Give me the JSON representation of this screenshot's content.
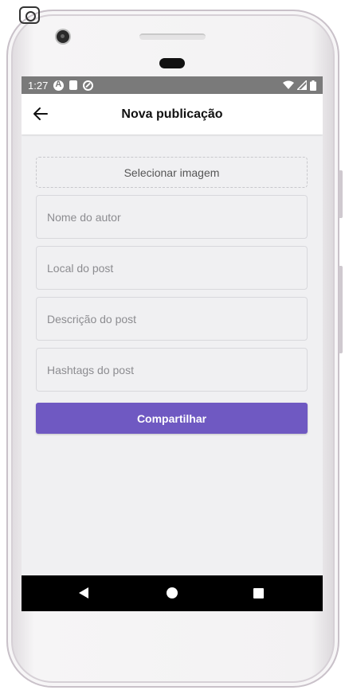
{
  "status_bar": {
    "time": "1:27",
    "icons": [
      "app-a-icon",
      "sd-card-icon",
      "do-not-disturb-icon",
      "wifi-icon",
      "signal-icon",
      "battery-icon"
    ]
  },
  "header": {
    "title": "Nova publicação",
    "back_icon": "arrow-left-icon"
  },
  "form": {
    "image_picker_label": "Selecionar imagem",
    "fields": [
      {
        "placeholder": "Nome do autor",
        "value": ""
      },
      {
        "placeholder": "Local do post",
        "value": ""
      },
      {
        "placeholder": "Descrição do post",
        "value": ""
      },
      {
        "placeholder": "Hashtags do post",
        "value": ""
      }
    ],
    "submit_label": "Compartilhar"
  },
  "colors": {
    "accent": "#6f59c2",
    "screen_bg": "#f0f0f2",
    "status_bar_bg": "#7a7a7a"
  },
  "nav_bar": {
    "icons": [
      "nav-back-icon",
      "nav-home-icon",
      "nav-recents-icon"
    ]
  }
}
